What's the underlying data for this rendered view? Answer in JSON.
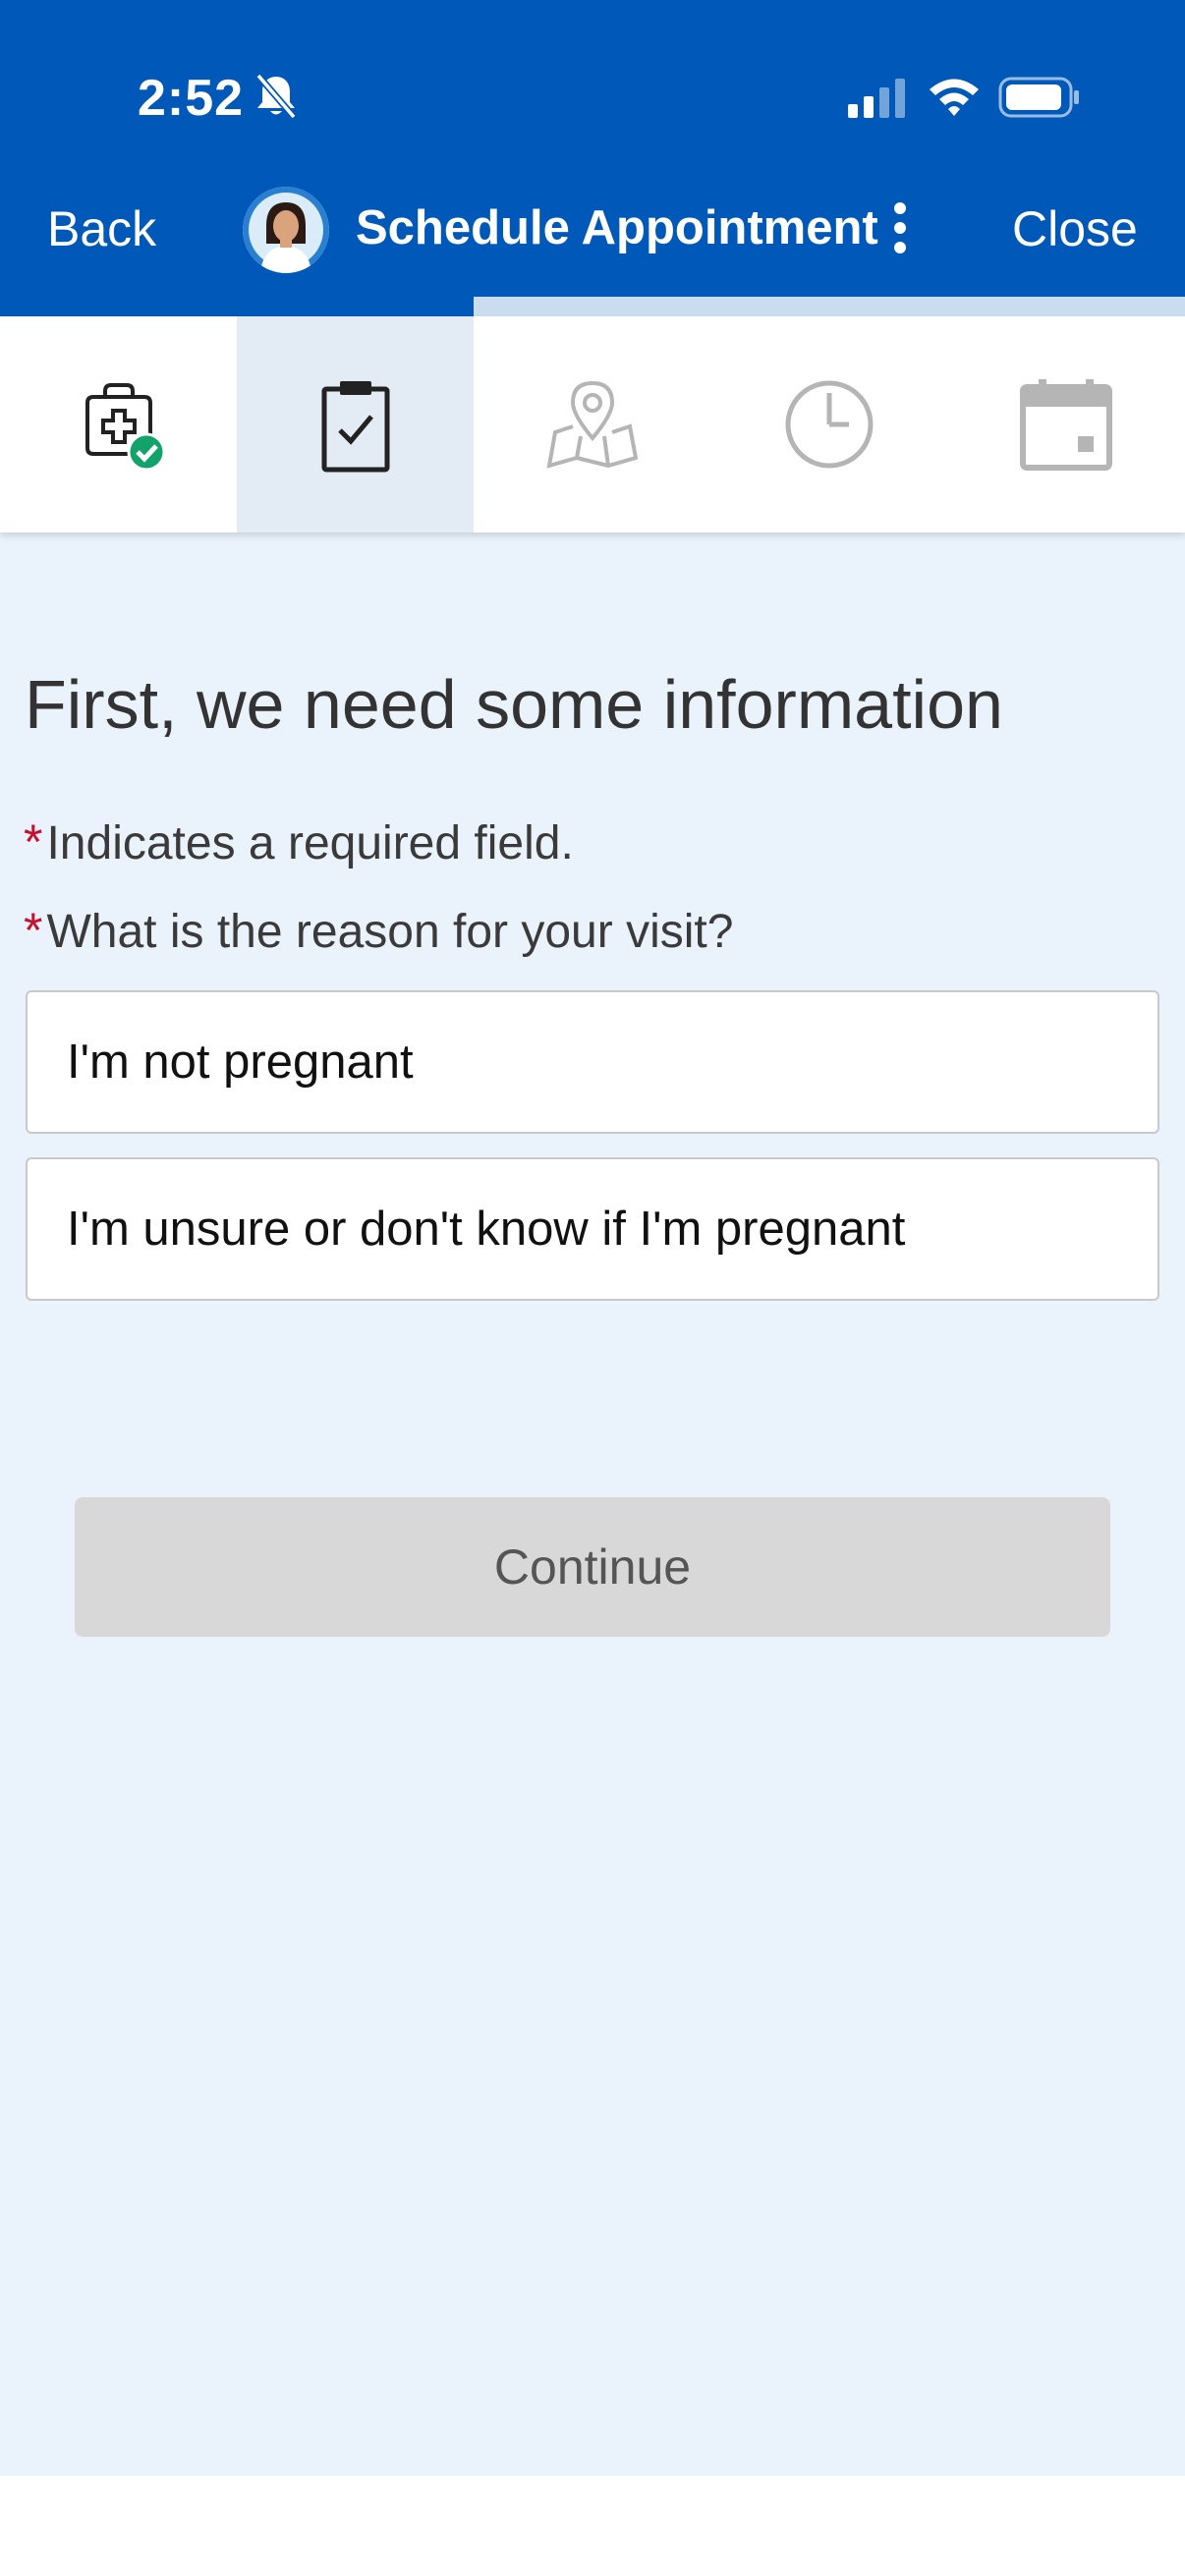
{
  "status_bar": {
    "time": "2:52",
    "icons": [
      "bell-off-icon",
      "signal-icon",
      "wifi-icon",
      "battery-icon"
    ]
  },
  "nav": {
    "back_label": "Back",
    "title": "Schedule Appointment",
    "close_label": "Close",
    "more_icon": "more-vertical-icon"
  },
  "progress": {
    "completed_fraction": 0.4
  },
  "steps": [
    {
      "icon": "medical-bag-check-icon",
      "state": "completed"
    },
    {
      "icon": "clipboard-check-icon",
      "state": "active"
    },
    {
      "icon": "map-location-icon",
      "state": "upcoming"
    },
    {
      "icon": "clock-icon",
      "state": "upcoming"
    },
    {
      "icon": "calendar-icon",
      "state": "upcoming"
    }
  ],
  "form": {
    "heading": "First, we need some information",
    "required_note": "Indicates a required field.",
    "question": "What is the reason for your visit?",
    "asterisk": "*",
    "options": [
      "I'm not pregnant",
      "I'm unsure or don't know if I'm pregnant"
    ],
    "continue_label": "Continue"
  },
  "colors": {
    "header_blue": "#0059b8",
    "progress_track": "#cadcf0",
    "page_background": "#eaf2fb",
    "active_step": "#e3ebf5",
    "required_red": "#c8102e",
    "disabled_button": "#d8d8d8",
    "success_green": "#12a36a"
  }
}
